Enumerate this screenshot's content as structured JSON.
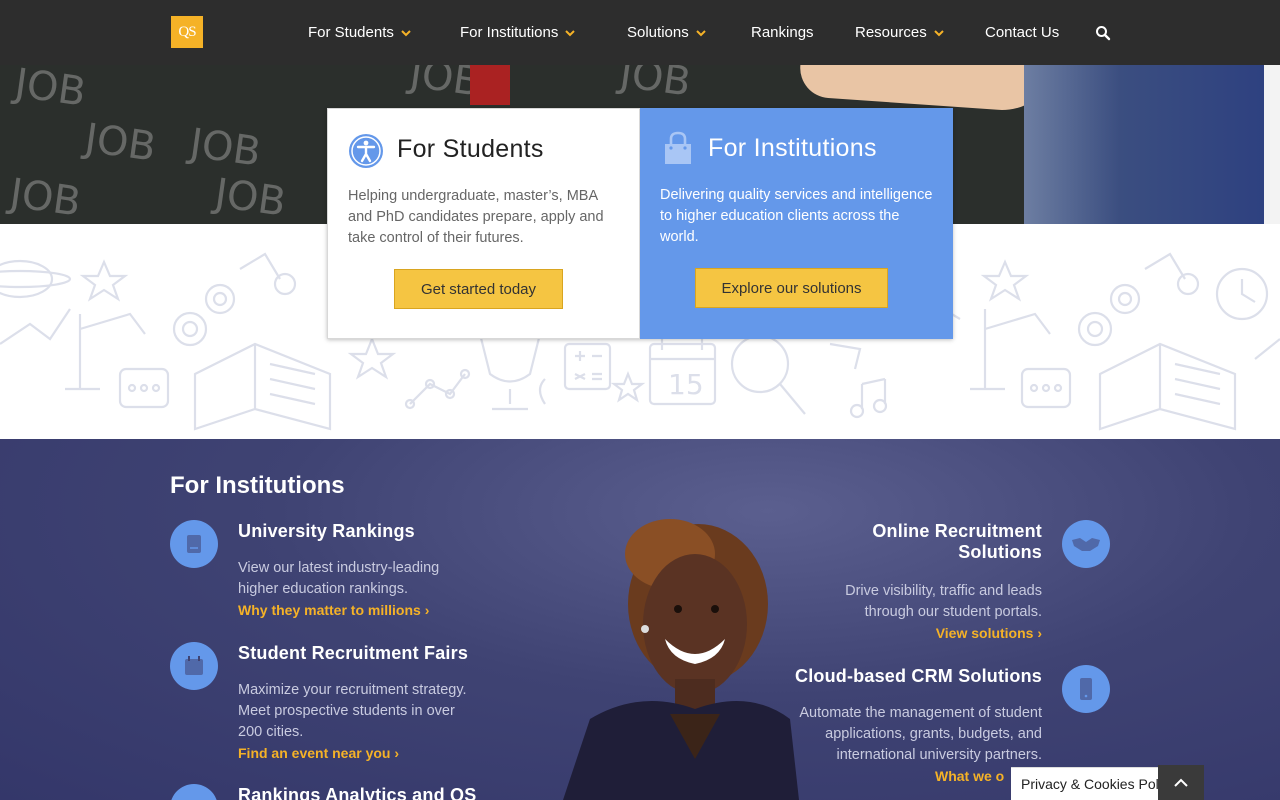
{
  "brand": {
    "logo_text": "QS",
    "accent": "#f5b227"
  },
  "nav": {
    "items": [
      {
        "label": "For Students",
        "has_dropdown": true
      },
      {
        "label": "For Institutions",
        "has_dropdown": true
      },
      {
        "label": "Solutions",
        "has_dropdown": true
      },
      {
        "label": "Rankings",
        "has_dropdown": false
      },
      {
        "label": "Resources",
        "has_dropdown": true
      },
      {
        "label": "Contact Us",
        "has_dropdown": false
      }
    ],
    "search_icon": "search-icon"
  },
  "hero": {
    "chalk_words": [
      "JOB",
      "JOB",
      "JOB",
      "JOB",
      "JOB",
      "JOB",
      "JOB"
    ]
  },
  "cards": {
    "students": {
      "title": "For Students",
      "text": "Helping undergraduate, master’s, MBA and PhD candidates prepare, apply and take control of their futures.",
      "button": "Get started today",
      "icon": "accessibility-icon"
    },
    "institutions": {
      "title": "For Institutions",
      "text": "Delivering quality services and intelligence to higher education clients across the world.",
      "button": "Explore our solutions",
      "icon": "shopping-bag-icon",
      "color": "#6498ea"
    }
  },
  "inst_section": {
    "title": "For Institutions",
    "left": [
      {
        "title": "University Rankings",
        "text": "View our latest industry-leading higher education rankings.",
        "link": "Why they matter to millions ›",
        "icon": "book-icon"
      },
      {
        "title": "Student Recruitment Fairs",
        "text": "Maximize your recruitment strategy. Meet prospective students in over 200 cities.",
        "link": "Find an event near you ›",
        "icon": "calendar-icon"
      },
      {
        "title": "Rankings Analytics and QS",
        "icon": "chart-icon"
      }
    ],
    "right": [
      {
        "title": "Online Recruitment Solutions",
        "text": "Drive visibility, traffic and leads through our student portals.",
        "link": "View solutions ›",
        "icon": "handshake-icon"
      },
      {
        "title": "Cloud-based CRM Solutions",
        "text": "Automate the management of student applications, grants, budgets, and international university partners.",
        "link": "What we o",
        "icon": "mobile-icon"
      }
    ]
  },
  "cookie": {
    "label": "Privacy & Cookies Policy"
  },
  "back_to_top": {
    "icon": "chevron-up-icon"
  }
}
